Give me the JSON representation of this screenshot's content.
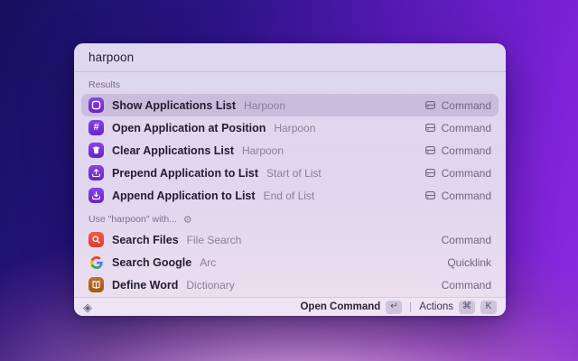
{
  "search": {
    "value": "harpoon"
  },
  "colors": {
    "accent_purple": "#7430d4",
    "selection": "#c9bddd",
    "search_files_tile": "#e8453c",
    "dictionary_tile": "#a9661f",
    "desktop_gradient": [
      "#17105e",
      "#7d22d8",
      "#e0a8d8"
    ]
  },
  "sections": [
    {
      "label": "Results",
      "rows": [
        {
          "title": "Show Applications List",
          "subtitle": "Harpoon",
          "accessory": "Command",
          "icon": "app-window-list-icon",
          "has_accessory_icon": true,
          "selected": true
        },
        {
          "title": "Open Application at Position",
          "subtitle": "Harpoon",
          "accessory": "Command",
          "icon": "hash-icon",
          "has_accessory_icon": true,
          "selected": false
        },
        {
          "title": "Clear Applications List",
          "subtitle": "Harpoon",
          "accessory": "Command",
          "icon": "trash-icon",
          "has_accessory_icon": true,
          "selected": false
        },
        {
          "title": "Prepend Application to List",
          "subtitle": "Start of List",
          "accessory": "Command",
          "icon": "upload-tray-icon",
          "has_accessory_icon": true,
          "selected": false
        },
        {
          "title": "Append Application to List",
          "subtitle": "End of List",
          "accessory": "Command",
          "icon": "download-tray-icon",
          "has_accessory_icon": true,
          "selected": false
        }
      ]
    },
    {
      "label": "Use \"harpoon\" with...",
      "label_icon": "gear-icon",
      "rows": [
        {
          "title": "Search Files",
          "subtitle": "File Search",
          "accessory": "Command",
          "icon": "search-icon",
          "has_accessory_icon": false,
          "selected": false
        },
        {
          "title": "Search Google",
          "subtitle": "Arc",
          "accessory": "Quicklink",
          "icon": "google-g-icon",
          "has_accessory_icon": false,
          "selected": false
        },
        {
          "title": "Define Word",
          "subtitle": "Dictionary",
          "accessory": "Command",
          "icon": "dictionary-icon",
          "has_accessory_icon": false,
          "selected": false
        }
      ]
    }
  ],
  "selected_index": 0,
  "glyphs": {
    "gear": "⚙",
    "return_key": "↵",
    "cmd_key": "⌘",
    "k_key": "K",
    "raycast_logo": "◈"
  },
  "footer": {
    "primary_action": "Open Command",
    "primary_key": "↵",
    "actions_label": "Actions",
    "actions_keys": [
      "⌘",
      "K"
    ]
  }
}
